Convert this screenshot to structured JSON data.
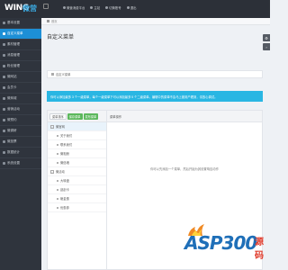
{
  "logo": {
    "brand": "WING",
    "brand_cn": "微营"
  },
  "topnav": [
    {
      "label": "微营消费平台"
    },
    {
      "label": "主站"
    },
    {
      "label": "切换账号"
    },
    {
      "label": "退出"
    }
  ],
  "sidebar": {
    "items": [
      {
        "label": "基本设置",
        "active": false
      },
      {
        "label": "自定义菜单",
        "active": true
      },
      {
        "label": "素材管理",
        "active": false
      },
      {
        "label": "消息管理",
        "active": false
      },
      {
        "label": "粉丝管理",
        "active": false
      },
      {
        "label": "微网站",
        "active": false
      },
      {
        "label": "会员卡",
        "active": false
      },
      {
        "label": "微商城",
        "active": false
      },
      {
        "label": "营销活动",
        "active": false
      },
      {
        "label": "微预约",
        "active": false
      },
      {
        "label": "微调研",
        "active": false
      },
      {
        "label": "微投票",
        "active": false
      },
      {
        "label": "数据统计",
        "active": false
      },
      {
        "label": "系统设置",
        "active": false
      }
    ]
  },
  "breadcrumb": {
    "current": "首页"
  },
  "page": {
    "title": "自定义菜单"
  },
  "panel": {
    "heading": "自定义菜单"
  },
  "alert": {
    "text": "你可以添加最多 3 个一级菜单，每个一级菜单下可以添加最多 5 个二级菜单。编辑中的菜单不会马上被用户看到，请放心调试。"
  },
  "editor": {
    "toolbar": {
      "sort": "菜单排序",
      "save": "保存菜单",
      "publish": "发布菜单"
    },
    "right_header": "菜单操作",
    "hint": "你可以先添加一个菜单，然后开始为其设置响应动作",
    "tree": [
      {
        "label": "微官网",
        "level": "parent"
      },
      {
        "label": "关于我们",
        "level": "child"
      },
      {
        "label": "联系我们",
        "level": "child"
      },
      {
        "label": "微相册",
        "level": "child"
      },
      {
        "label": "微信墙",
        "level": "child"
      },
      {
        "label": "微活动",
        "level": "parent"
      },
      {
        "label": "大转盘",
        "level": "child"
      },
      {
        "label": "刮刮卡",
        "level": "child"
      },
      {
        "label": "砸金蛋",
        "level": "child"
      },
      {
        "label": "优惠券",
        "level": "child"
      }
    ]
  },
  "watermark": {
    "text": "ASP300",
    "cn": "源码"
  }
}
